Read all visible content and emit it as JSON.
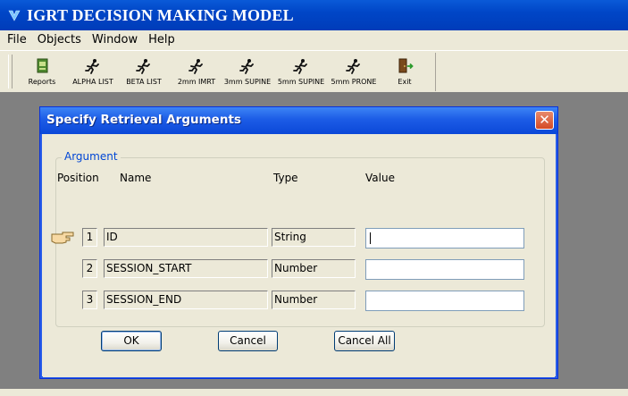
{
  "app": {
    "title": "IGRT DECISION MAKING MODEL"
  },
  "menu": [
    "File",
    "Objects",
    "Window",
    "Help"
  ],
  "toolbar": {
    "buttons": [
      {
        "label": "Reports",
        "icon": "report-icon"
      },
      {
        "label": "ALPHA LIST",
        "icon": "runner-icon"
      },
      {
        "label": "BETA LIST",
        "icon": "runner-icon"
      },
      {
        "label": "2mm IMRT",
        "icon": "runner-icon"
      },
      {
        "label": "3mm SUPINE",
        "icon": "runner-icon"
      },
      {
        "label": "5mm SUPINE",
        "icon": "runner-icon"
      },
      {
        "label": "5mm PRONE",
        "icon": "runner-icon"
      },
      {
        "label": "Exit",
        "icon": "exit-door-icon"
      }
    ]
  },
  "dialog": {
    "title": "Specify Retrieval Arguments",
    "group_label": "Argument",
    "headers": {
      "position": "Position",
      "name": "Name",
      "type": "Type",
      "value": "Value"
    },
    "rows": [
      {
        "position": "1",
        "name": "ID",
        "type": "String",
        "value": ""
      },
      {
        "position": "2",
        "name": "SESSION_START",
        "type": "Number",
        "value": ""
      },
      {
        "position": "3",
        "name": "SESSION_END",
        "type": "Number",
        "value": ""
      }
    ],
    "buttons": {
      "ok": "OK",
      "cancel": "Cancel",
      "cancel_all": "Cancel All"
    }
  },
  "colors": {
    "title_bar": "#0046c7",
    "dialog_title_bar": "#1c5ce6",
    "close_button": "#d54a25",
    "workspace": "#808080",
    "window_face": "#ece9d8",
    "group_label": "#0046d5"
  }
}
